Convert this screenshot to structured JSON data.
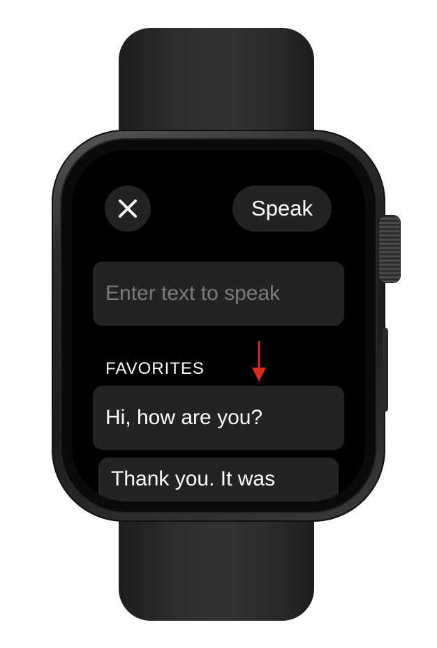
{
  "toolbar": {
    "close_icon": "close-icon",
    "speak_label": "Speak"
  },
  "input": {
    "placeholder": "Enter text to speak"
  },
  "favorites": {
    "header": "FAVORITES",
    "items": [
      {
        "label": "Hi, how are you?"
      },
      {
        "label": "Thank you. It was"
      }
    ]
  },
  "colors": {
    "screen_background": "#000000",
    "control_background": "#232323",
    "placeholder_text": "#7a7a7a",
    "text": "#ffffff",
    "annotation_arrow": "#e02b1c"
  }
}
